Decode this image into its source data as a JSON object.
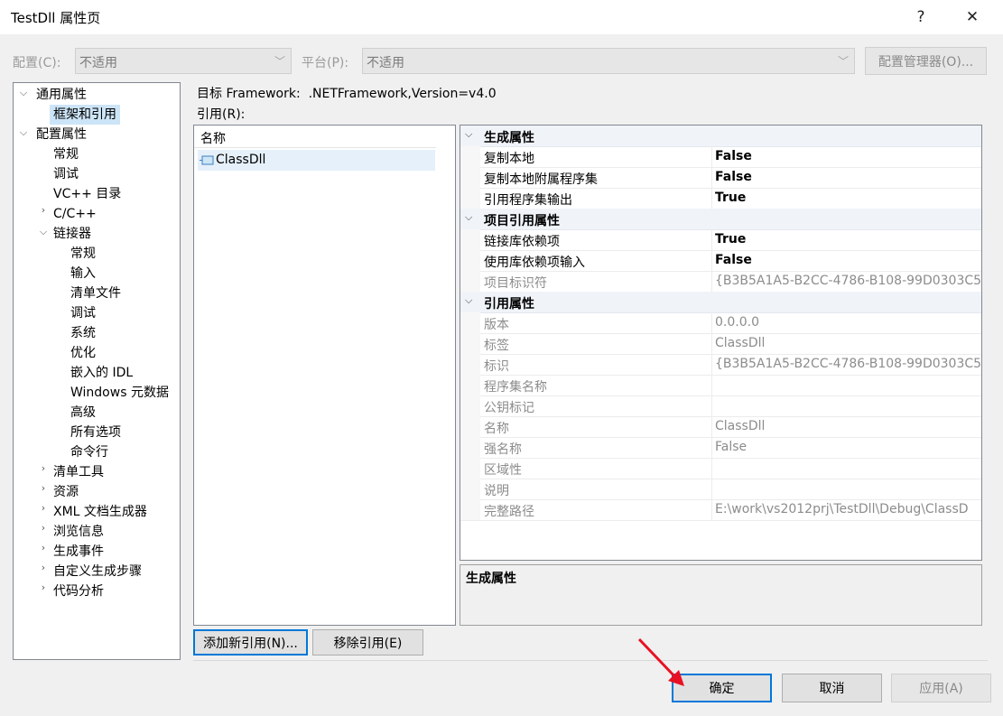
{
  "window": {
    "title": "TestDll 属性页",
    "help_label": "?",
    "close_label": "✕"
  },
  "config_bar": {
    "config_label": "配置(C):",
    "config_value": "不适用",
    "platform_label": "平台(P):",
    "platform_value": "不适用",
    "manager_label": "配置管理器(O)..."
  },
  "tree": {
    "common": "通用属性",
    "framework_refs": "框架和引用",
    "config_props": "配置属性",
    "general": "常规",
    "debug": "调试",
    "vc_dirs": "VC++ 目录",
    "cpp": "C/C++",
    "linker": "链接器",
    "linker_items": [
      "常规",
      "输入",
      "清单文件",
      "调试",
      "系统",
      "优化",
      "嵌入的 IDL",
      "Windows 元数据",
      "高级",
      "所有选项",
      "命令行"
    ],
    "after_items": [
      "清单工具",
      "资源",
      "XML 文档生成器",
      "浏览信息",
      "生成事件",
      "自定义生成步骤",
      "代码分析"
    ]
  },
  "main": {
    "target_framework": "目标 Framework:  .NETFramework,Version=v4.0",
    "refs_label": "引用(R):",
    "refs_header": "名称",
    "refs": [
      "ClassDll"
    ],
    "add_ref_label": "添加新引用(N)...",
    "remove_ref_label": "移除引用(E)"
  },
  "props": {
    "cat_build": "生成属性",
    "copy_local": "复制本地",
    "copy_local_val": "False",
    "copy_local_deps": "复制本地附属程序集",
    "copy_local_deps_val": "False",
    "ref_asm_output": "引用程序集输出",
    "ref_asm_output_val": "True",
    "cat_project": "项目引用属性",
    "link_deps": "链接库依赖项",
    "link_deps_val": "True",
    "use_link_inputs": "使用库依赖项输入",
    "use_link_inputs_val": "False",
    "project_id": "项目标识符",
    "project_id_val": "{B3B5A1A5-B2CC-4786-B108-99D0303C5",
    "cat_ref": "引用属性",
    "version": "版本",
    "version_val": "0.0.0.0",
    "tag": "标签",
    "tag_val": "ClassDll",
    "identity": "标识",
    "identity_val": "{B3B5A1A5-B2CC-4786-B108-99D0303C5",
    "asm_name": "程序集名称",
    "asm_name_val": "",
    "public_key": "公钥标记",
    "public_key_val": "",
    "name": "名称",
    "name_val": "ClassDll",
    "strong_name": "强名称",
    "strong_name_val": "False",
    "culture": "区域性",
    "culture_val": "",
    "description": "说明",
    "description_val": "",
    "full_path": "完整路径",
    "full_path_val": "E:\\work\\vs2012prj\\TestDll\\Debug\\ClassD",
    "desc_title": "生成属性"
  },
  "footer": {
    "ok_label": "确定",
    "cancel_label": "取消",
    "apply_label": "应用(A)"
  },
  "colors": {
    "accent": "#0078d7",
    "annotation_arrow": "#e81123"
  }
}
